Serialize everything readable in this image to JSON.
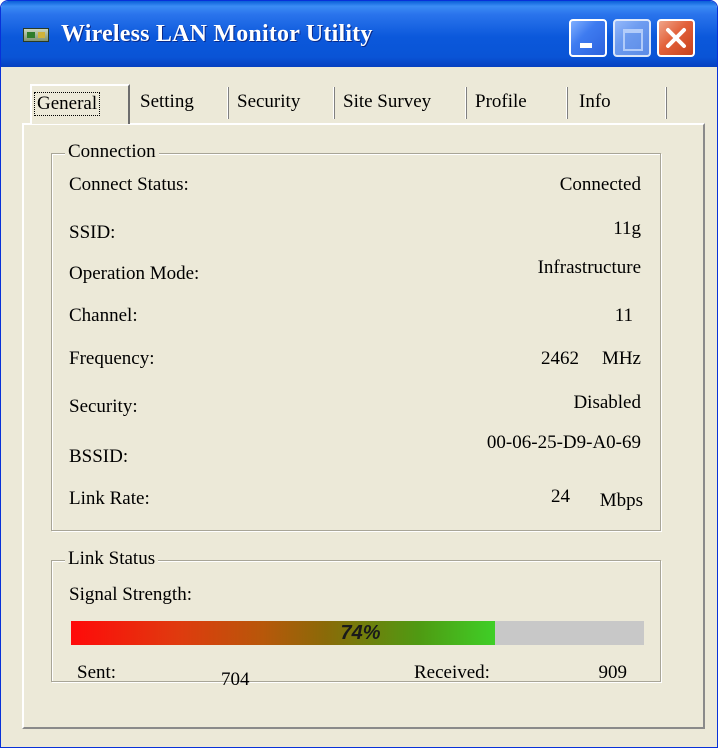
{
  "window": {
    "title": "Wireless LAN Monitor Utility",
    "accent_color": "#0a54d6",
    "background_color": "#ece9d8"
  },
  "tabs": [
    {
      "label": "General",
      "active": true
    },
    {
      "label": "Setting",
      "active": false
    },
    {
      "label": "Security",
      "active": false
    },
    {
      "label": "Site Survey",
      "active": false
    },
    {
      "label": "Profile",
      "active": false
    },
    {
      "label": "Info",
      "active": false
    }
  ],
  "connection": {
    "group_title": "Connection",
    "rows": [
      {
        "label": "Connect Status:",
        "value": "Connected"
      },
      {
        "label": "SSID:",
        "value": "11g"
      },
      {
        "label": "Operation Mode:",
        "value": "Infrastructure"
      },
      {
        "label": "Channel:",
        "value": "11"
      },
      {
        "label": "Frequency:",
        "value": "2462",
        "unit": "MHz"
      },
      {
        "label": "Security:",
        "value": "Disabled"
      },
      {
        "label": "BSSID:",
        "value": "00-06-25-D9-A0-69"
      },
      {
        "label": "Link Rate:",
        "value": "24",
        "unit": "Mbps"
      }
    ]
  },
  "link_status": {
    "group_title": "Link Status",
    "signal_label": "Signal Strength:",
    "signal_percent": 74,
    "signal_text": "74%",
    "sent_label": "Sent:",
    "sent_value": "704",
    "received_label": "Received:",
    "received_value": "909"
  },
  "icons": {
    "app": "network-card-icon",
    "minimize": "minimize-icon",
    "maximize": "maximize-icon",
    "close": "close-icon"
  }
}
